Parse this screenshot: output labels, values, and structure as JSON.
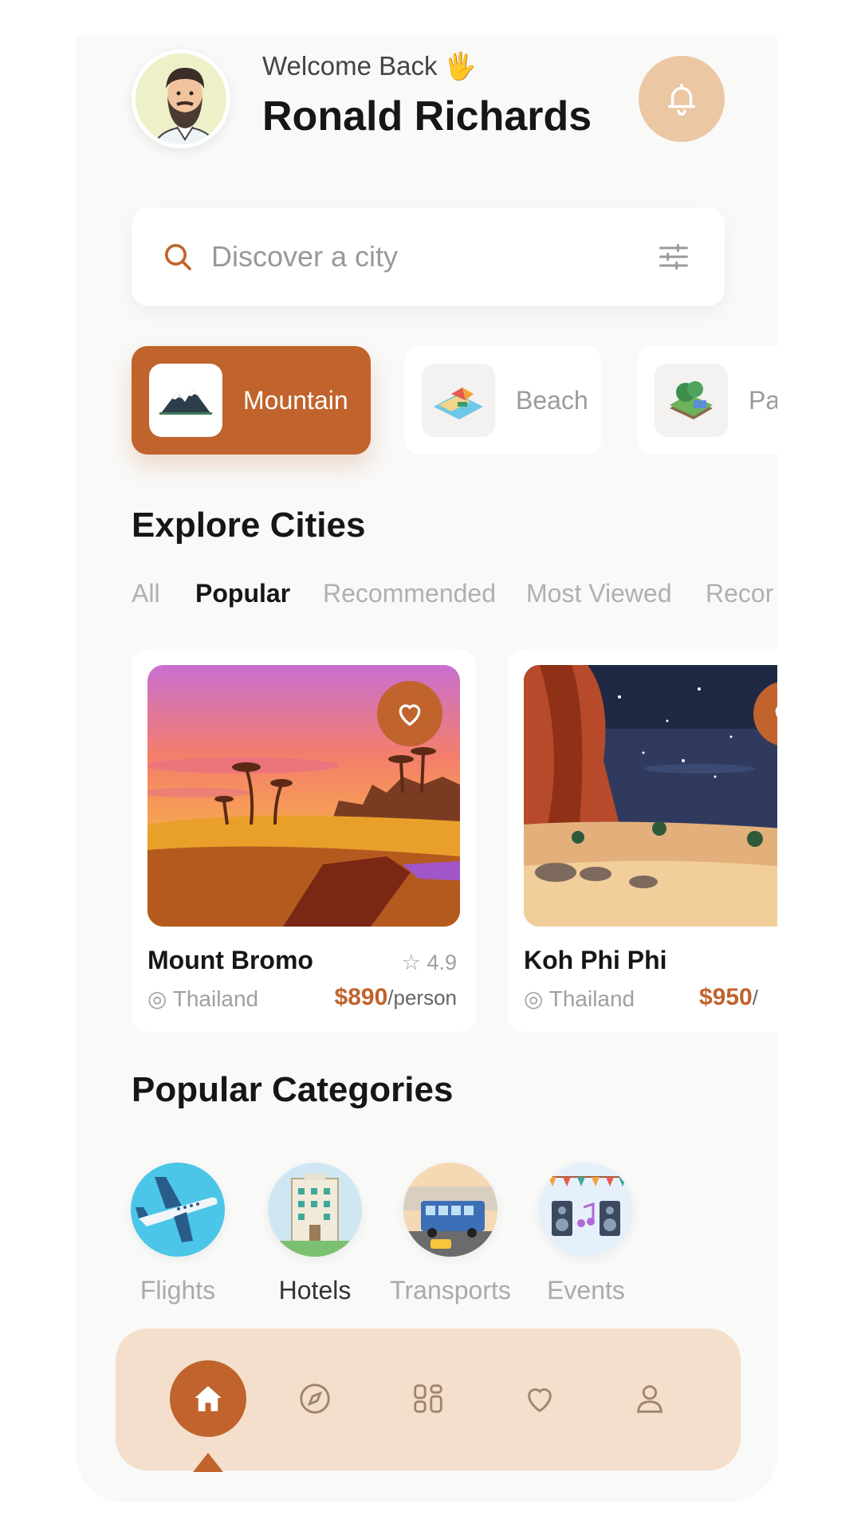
{
  "header": {
    "welcome_text": "Welcome Back",
    "wave_emoji": "🖐",
    "user_name": "Ronald Richards"
  },
  "search": {
    "placeholder": "Discover a city"
  },
  "chips": [
    {
      "label": "Mountain",
      "active": true
    },
    {
      "label": "Beach",
      "active": false
    },
    {
      "label": "Par",
      "active": false
    }
  ],
  "explore": {
    "title": "Explore Cities",
    "tabs": [
      "All",
      "Popular",
      "Recommended",
      "Most Viewed",
      "Recor"
    ],
    "active_tab": "Popular"
  },
  "cities": [
    {
      "name": "Mount Bromo",
      "rating": "4.9",
      "location": "Thailand",
      "price": "$890",
      "unit": "/person"
    },
    {
      "name": "Koh Phi Phi",
      "rating": "",
      "location": "Thailand",
      "price": "$950",
      "unit": "/"
    }
  ],
  "popular_categories": {
    "title": "Popular Categories",
    "items": [
      {
        "label": "Flights",
        "active": false
      },
      {
        "label": "Hotels",
        "active": true
      },
      {
        "label": "Transports",
        "active": false
      },
      {
        "label": "Events",
        "active": false
      }
    ]
  },
  "nav": {
    "active": "home",
    "items": [
      "home-icon",
      "compass-icon",
      "grid-icon",
      "heart-icon",
      "profile-icon"
    ]
  },
  "colors": {
    "accent": "#c0632c",
    "bell_bg": "#ecc7a4",
    "nav_bg": "#f3dfcb",
    "page_bg": "#f9f9f8"
  }
}
